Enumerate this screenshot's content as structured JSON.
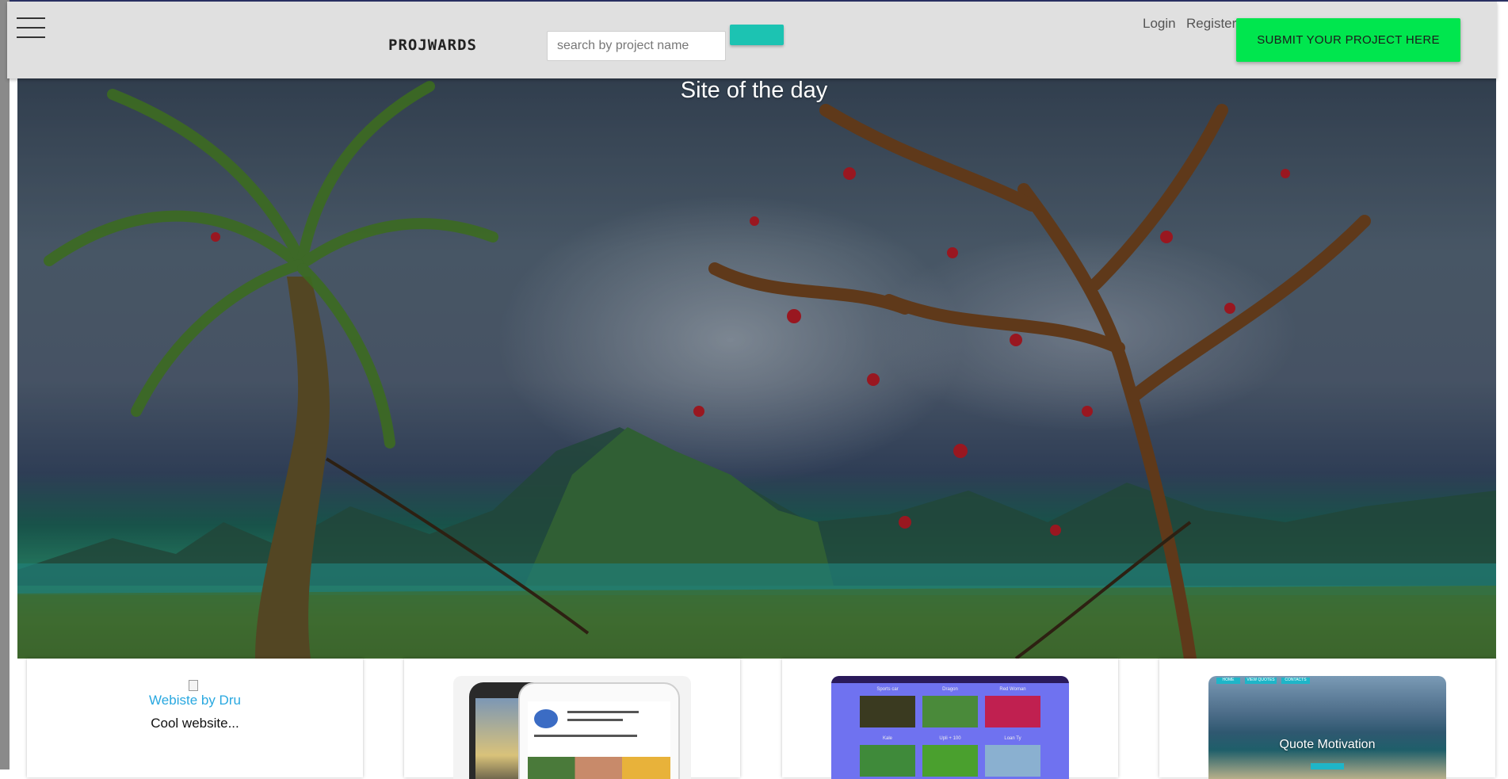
{
  "header": {
    "brand": "PROJWARDS",
    "search_placeholder": "search by project name",
    "search_button_label": "",
    "login_label": "Login",
    "register_label": "Register",
    "submit_label": "SUBMIT YOUR PROJECT HERE"
  },
  "hero": {
    "title": "Site of the day"
  },
  "cards": [
    {
      "link_text": "Webiste by Dru",
      "description": "Cool website..."
    },
    {
      "image": "instagram-clone-screenshot"
    },
    {
      "image": "gallery-site-screenshot",
      "labels": [
        "Sports car",
        "Dragon",
        "Red Woman",
        "Kale",
        "Upli + 100",
        "Loan Ty"
      ]
    },
    {
      "title": "Quote Motivation",
      "nav": [
        "HOME",
        "VIEW QUOTES",
        "CONTACTS"
      ]
    }
  ],
  "colors": {
    "navbar_bg": "#e0e0e0",
    "submit_bg": "#00e64e",
    "search_button_bg": "#1cc3b2",
    "link": "#29a8e0"
  },
  "icons": {
    "menu": "hamburger-icon",
    "broken_image": "broken-image-icon"
  }
}
